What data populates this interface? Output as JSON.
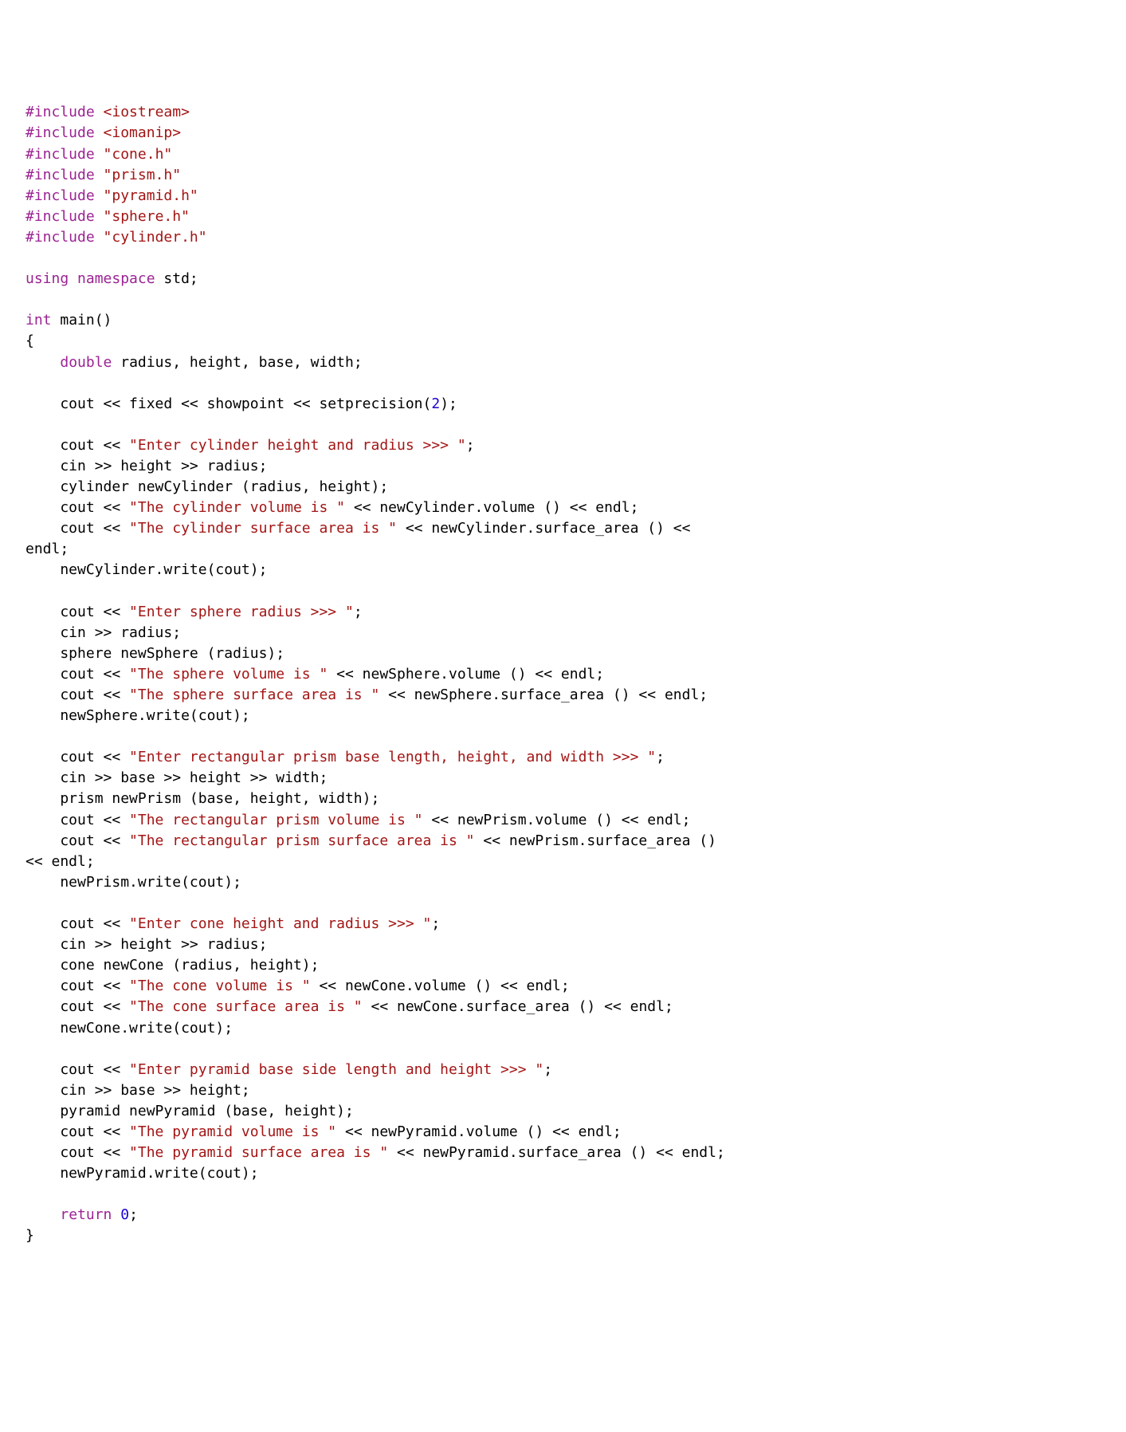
{
  "code": {
    "tokens": [
      {
        "t": "#include ",
        "c": "pp"
      },
      {
        "t": "<iostream>",
        "c": "sys"
      },
      {
        "t": "\n",
        "c": "plain"
      },
      {
        "t": "#include ",
        "c": "pp"
      },
      {
        "t": "<iomanip>",
        "c": "sys"
      },
      {
        "t": "\n",
        "c": "plain"
      },
      {
        "t": "#include ",
        "c": "pp"
      },
      {
        "t": "\"cone.h\"",
        "c": "str"
      },
      {
        "t": "\n",
        "c": "plain"
      },
      {
        "t": "#include ",
        "c": "pp"
      },
      {
        "t": "\"prism.h\"",
        "c": "str"
      },
      {
        "t": "\n",
        "c": "plain"
      },
      {
        "t": "#include ",
        "c": "pp"
      },
      {
        "t": "\"pyramid.h\"",
        "c": "str"
      },
      {
        "t": "\n",
        "c": "plain"
      },
      {
        "t": "#include ",
        "c": "pp"
      },
      {
        "t": "\"sphere.h\"",
        "c": "str"
      },
      {
        "t": "\n",
        "c": "plain"
      },
      {
        "t": "#include ",
        "c": "pp"
      },
      {
        "t": "\"cylinder.h\"",
        "c": "str"
      },
      {
        "t": "\n",
        "c": "plain"
      },
      {
        "t": "\n",
        "c": "plain"
      },
      {
        "t": "using namespace",
        "c": "kw"
      },
      {
        "t": " std;\n",
        "c": "plain"
      },
      {
        "t": "\n",
        "c": "plain"
      },
      {
        "t": "int",
        "c": "kw"
      },
      {
        "t": " main()\n",
        "c": "plain"
      },
      {
        "t": "{\n",
        "c": "plain"
      },
      {
        "t": "    ",
        "c": "plain"
      },
      {
        "t": "double",
        "c": "kw"
      },
      {
        "t": " radius, height, base, width;\n",
        "c": "plain"
      },
      {
        "t": "\n",
        "c": "plain"
      },
      {
        "t": "    cout << fixed << showpoint << setprecision(",
        "c": "plain"
      },
      {
        "t": "2",
        "c": "num"
      },
      {
        "t": ");\n",
        "c": "plain"
      },
      {
        "t": "\n",
        "c": "plain"
      },
      {
        "t": "    cout << ",
        "c": "plain"
      },
      {
        "t": "\"Enter cylinder height and radius >>> \"",
        "c": "str"
      },
      {
        "t": ";\n",
        "c": "plain"
      },
      {
        "t": "    cin >> height >> radius;\n",
        "c": "plain"
      },
      {
        "t": "    cylinder newCylinder (radius, height);\n",
        "c": "plain"
      },
      {
        "t": "    cout << ",
        "c": "plain"
      },
      {
        "t": "\"The cylinder volume is \"",
        "c": "str"
      },
      {
        "t": " << newCylinder.volume () << endl;\n",
        "c": "plain"
      },
      {
        "t": "    cout << ",
        "c": "plain"
      },
      {
        "t": "\"The cylinder surface area is \"",
        "c": "str"
      },
      {
        "t": " << newCylinder.surface_area () <<\nendl;\n",
        "c": "plain"
      },
      {
        "t": "    newCylinder.write(cout);\n",
        "c": "plain"
      },
      {
        "t": "\n",
        "c": "plain"
      },
      {
        "t": "    cout << ",
        "c": "plain"
      },
      {
        "t": "\"Enter sphere radius >>> \"",
        "c": "str"
      },
      {
        "t": ";\n",
        "c": "plain"
      },
      {
        "t": "    cin >> radius;\n",
        "c": "plain"
      },
      {
        "t": "    sphere newSphere (radius);\n",
        "c": "plain"
      },
      {
        "t": "    cout << ",
        "c": "plain"
      },
      {
        "t": "\"The sphere volume is \"",
        "c": "str"
      },
      {
        "t": " << newSphere.volume () << endl;\n",
        "c": "plain"
      },
      {
        "t": "    cout << ",
        "c": "plain"
      },
      {
        "t": "\"The sphere surface area is \"",
        "c": "str"
      },
      {
        "t": " << newSphere.surface_area () << endl;\n",
        "c": "plain"
      },
      {
        "t": "    newSphere.write(cout);\n",
        "c": "plain"
      },
      {
        "t": "\n",
        "c": "plain"
      },
      {
        "t": "    cout << ",
        "c": "plain"
      },
      {
        "t": "\"Enter rectangular prism base length, height, and width >>> \"",
        "c": "str"
      },
      {
        "t": ";\n",
        "c": "plain"
      },
      {
        "t": "    cin >> base >> height >> width;\n",
        "c": "plain"
      },
      {
        "t": "    prism newPrism (base, height, width);\n",
        "c": "plain"
      },
      {
        "t": "    cout << ",
        "c": "plain"
      },
      {
        "t": "\"The rectangular prism volume is \"",
        "c": "str"
      },
      {
        "t": " << newPrism.volume () << endl;\n",
        "c": "plain"
      },
      {
        "t": "    cout << ",
        "c": "plain"
      },
      {
        "t": "\"The rectangular prism surface area is \"",
        "c": "str"
      },
      {
        "t": " << newPrism.surface_area ()\n<< endl;\n",
        "c": "plain"
      },
      {
        "t": "    newPrism.write(cout);\n",
        "c": "plain"
      },
      {
        "t": "\n",
        "c": "plain"
      },
      {
        "t": "    cout << ",
        "c": "plain"
      },
      {
        "t": "\"Enter cone height and radius >>> \"",
        "c": "str"
      },
      {
        "t": ";\n",
        "c": "plain"
      },
      {
        "t": "    cin >> height >> radius;\n",
        "c": "plain"
      },
      {
        "t": "    cone newCone (radius, height);\n",
        "c": "plain"
      },
      {
        "t": "    cout << ",
        "c": "plain"
      },
      {
        "t": "\"The cone volume is \"",
        "c": "str"
      },
      {
        "t": " << newCone.volume () << endl;\n",
        "c": "plain"
      },
      {
        "t": "    cout << ",
        "c": "plain"
      },
      {
        "t": "\"The cone surface area is \"",
        "c": "str"
      },
      {
        "t": " << newCone.surface_area () << endl;\n",
        "c": "plain"
      },
      {
        "t": "    newCone.write(cout);\n",
        "c": "plain"
      },
      {
        "t": "\n",
        "c": "plain"
      },
      {
        "t": "    cout << ",
        "c": "plain"
      },
      {
        "t": "\"Enter pyramid base side length and height >>> \"",
        "c": "str"
      },
      {
        "t": ";\n",
        "c": "plain"
      },
      {
        "t": "    cin >> base >> height;\n",
        "c": "plain"
      },
      {
        "t": "    pyramid newPyramid (base, height);\n",
        "c": "plain"
      },
      {
        "t": "    cout << ",
        "c": "plain"
      },
      {
        "t": "\"The pyramid volume is \"",
        "c": "str"
      },
      {
        "t": " << newPyramid.volume () << endl;\n",
        "c": "plain"
      },
      {
        "t": "    cout << ",
        "c": "plain"
      },
      {
        "t": "\"The pyramid surface area is \"",
        "c": "str"
      },
      {
        "t": " << newPyramid.surface_area () << endl;\n",
        "c": "plain"
      },
      {
        "t": "    newPyramid.write(cout);\n",
        "c": "plain"
      },
      {
        "t": "\n",
        "c": "plain"
      },
      {
        "t": "    ",
        "c": "plain"
      },
      {
        "t": "return",
        "c": "kw"
      },
      {
        "t": " ",
        "c": "plain"
      },
      {
        "t": "0",
        "c": "num"
      },
      {
        "t": ";\n",
        "c": "plain"
      },
      {
        "t": "}\n",
        "c": "plain"
      }
    ]
  }
}
